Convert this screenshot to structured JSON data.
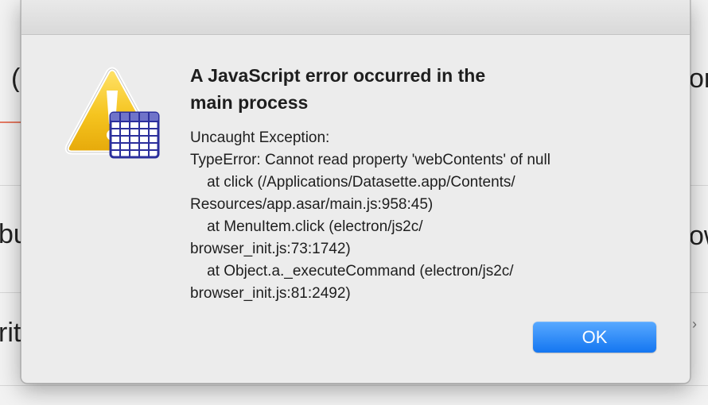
{
  "dialog": {
    "title": "A JavaScript error occurred in the\nmain process",
    "message": "Uncaught Exception:\nTypeError: Cannot read property 'webContents' of null\n    at click (/Applications/Datasette.app/Contents/\nResources/app.asar/main.js:958:45)\n    at MenuItem.click (electron/js2c/\nbrowser_init.js:73:1742)\n    at Object.a._executeCommand (electron/js2c/\nbrowser_init.js:81:2492)",
    "ok_label": "OK",
    "icon": "warning-table-icon"
  },
  "background": {
    "left_fragments": [
      "(",
      "bu",
      "rit"
    ],
    "right_fragments": [
      "on",
      "ow"
    ],
    "chevron": "›"
  },
  "colors": {
    "accent_button": "#1a7cf5",
    "warning_yellow": "#f3c21c",
    "table_blue": "#2b2f9c"
  }
}
